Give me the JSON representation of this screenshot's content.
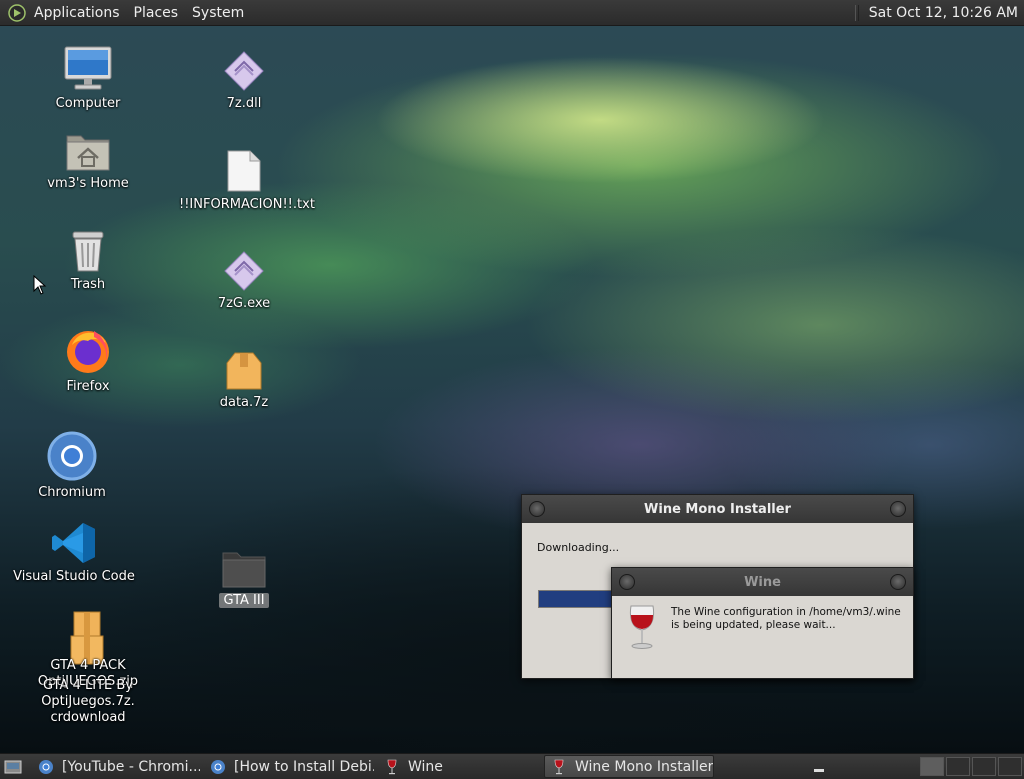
{
  "top_panel": {
    "menus": [
      "Applications",
      "Places",
      "System"
    ],
    "clock": "Sat Oct 12, 10:26 AM"
  },
  "desktop_icons": {
    "computer": "Computer",
    "home": "vm3's Home",
    "trash": "Trash",
    "firefox": "Firefox",
    "chromium": "Chromium",
    "vscode": "Visual Studio Code",
    "gta_pack_1": "GTA 4 PACK",
    "gta_pack_2": "OptiJUEGOS.zip",
    "gta_lite_1": "GTA 4 LITE By",
    "gta_lite_2": "OptiJuegos.7z.",
    "gta_lite_3": "crdownload",
    "dll": "7z.dll",
    "txt": "!!INFORMACION!!.txt",
    "exe": "7zG.exe",
    "data": "data.7z",
    "gta3": "GTA III"
  },
  "mono_window": {
    "title": "Wine Mono Installer",
    "status": "Downloading...",
    "progress": 0.22
  },
  "wine_window": {
    "title": "Wine",
    "message": "The Wine configuration in /home/vm3/.wine is being updated, please wait..."
  },
  "taskbar": {
    "tasks": [
      "[YouTube - Chromi...",
      "[How to Install Debi...",
      "Wine",
      "Wine Mono Installer"
    ]
  },
  "colors": {
    "panel": "#2f2f2f",
    "progress_fill": "#213e80",
    "dialog_bg": "#dad7d2"
  }
}
